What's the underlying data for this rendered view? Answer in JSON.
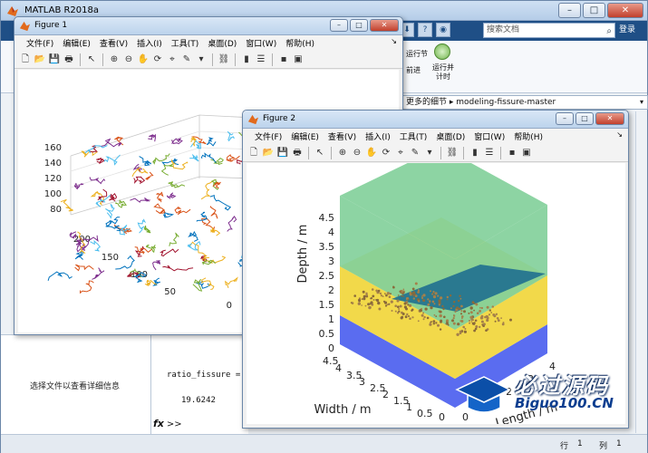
{
  "main_window": {
    "title": "MATLAB R2018a",
    "window_buttons": {
      "minimize": "–",
      "maximize": "□",
      "close": "✕"
    },
    "quick_access": [
      "⬇",
      "?",
      "◉"
    ],
    "search": {
      "placeholder": "搜索文档"
    },
    "login_label": "登录",
    "ribbon": {
      "run_section_label": "运行节",
      "advance_label": "前进",
      "run_time_label_1": "运行并",
      "run_time_label_2": "计时"
    },
    "address_bar": {
      "prefix": "更多的细节",
      "folder": "modeling-fissure-master"
    },
    "details_pane": {
      "text": "选择文件以查看详细信息"
    },
    "command_window": {
      "var_line": "ratio_fissure =",
      "value_line": "19.6242",
      "prompt": ">>"
    },
    "statusbar": {
      "row_label": "行",
      "row_value": "1",
      "col_label": "列",
      "col_value": "1"
    }
  },
  "figure1": {
    "title": "Figure 1",
    "menu": [
      "文件(F)",
      "编辑(E)",
      "查看(V)",
      "插入(I)",
      "工具(T)",
      "桌面(D)",
      "窗口(W)",
      "帮助(H)"
    ],
    "z_ticks": [
      "160",
      "140",
      "120",
      "100",
      "80"
    ],
    "y_ticks": [
      "200",
      "150",
      "100",
      "50",
      "0"
    ],
    "colors": [
      "#0072bd",
      "#d95319",
      "#edb120",
      "#7e2f8e",
      "#77ac30",
      "#4dbeee",
      "#a2142f"
    ]
  },
  "figure2": {
    "title": "Figure 2",
    "menu": [
      "文件(F)",
      "编辑(E)",
      "查看(V)",
      "插入(I)",
      "工具(T)",
      "桌面(D)",
      "窗口(W)",
      "帮助(H)"
    ],
    "zlabel": "Depth / m",
    "xlabel": "Width / m",
    "ylabel": "Length / m",
    "z_ticks": [
      "4.5",
      "4",
      "3.5",
      "3",
      "2.5",
      "2",
      "1.5",
      "1",
      "0.5",
      "0"
    ],
    "width_ticks": [
      "4.5",
      "4",
      "3.5",
      "3",
      "2.5",
      "2",
      "1.5",
      "1",
      "0.5",
      "0"
    ],
    "length_ticks": [
      "0",
      "1",
      "2",
      "3",
      "4"
    ],
    "layer_colors": {
      "bottom": "#5a6cf0",
      "middle": "#f2d94a",
      "top": "#79cc93",
      "fissure": "#1f6f8f"
    }
  },
  "watermark": {
    "cn": "必过源码",
    "en": "Biguo100.CN"
  }
}
